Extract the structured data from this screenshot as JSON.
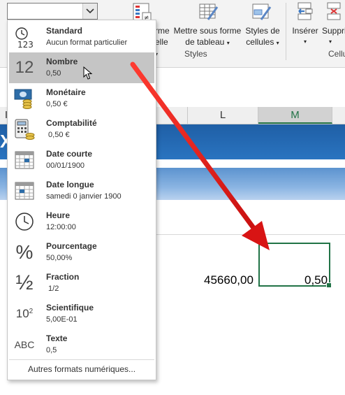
{
  "ribbon": {
    "btn_mise_en_forme_line1": "rme",
    "btn_mise_en_forme_line2": "elle",
    "btn_tableau_line1": "Mettre sous forme",
    "btn_tableau_line2": "de tableau",
    "btn_styles_line1": "Styles de",
    "btn_styles_line2": "cellules",
    "group_styles": "Styles",
    "btn_inserer": "Insérer",
    "btn_supprimer": "Suppri",
    "group_cellules": "Cellu"
  },
  "columns": {
    "i": "I",
    "l": "L",
    "m": "M"
  },
  "band_fragment": "X",
  "cells": {
    "l_value": "45660,00",
    "m_value": "0,50"
  },
  "format_combo": {
    "value": ""
  },
  "format_menu": {
    "items": [
      {
        "name": "Standard",
        "sample": "Aucun format particulier",
        "icon": "clock-123-icon",
        "icon_text": "123"
      },
      {
        "name": "Nombre",
        "sample": "0,50",
        "icon": "number-12-icon",
        "icon_text": "12"
      },
      {
        "name": "Monétaire",
        "sample": "0,50 €",
        "icon": "currency-icon",
        "icon_text": ""
      },
      {
        "name": "Comptabilité",
        "sample": " 0,50 €",
        "icon": "calculator-icon",
        "icon_text": ""
      },
      {
        "name": "Date courte",
        "sample": "00/01/1900",
        "icon": "calendar-short-icon",
        "icon_text": ""
      },
      {
        "name": "Date longue",
        "sample": "samedi 0 janvier 1900",
        "icon": "calendar-long-icon",
        "icon_text": ""
      },
      {
        "name": "Heure",
        "sample": "12:00:00",
        "icon": "clock-icon",
        "icon_text": ""
      },
      {
        "name": "Pourcentage",
        "sample": "50,00%",
        "icon": "percent-icon",
        "icon_text": "%"
      },
      {
        "name": "Fraction",
        "sample": " 1/2",
        "icon": "fraction-icon",
        "icon_text": "½"
      },
      {
        "name": "Scientifique",
        "sample": "5,00E-01",
        "icon": "scientific-icon",
        "icon_text": "10"
      },
      {
        "name": "Texte",
        "sample": "0,5",
        "icon": "abc-icon",
        "icon_text": "ABC"
      }
    ],
    "footer_link": "Autres formats numériques..."
  },
  "colors": {
    "accent": "#217346",
    "arrow": "#e02020",
    "band_dark": "#1f5fa6",
    "hover": "#c5c5c5"
  }
}
